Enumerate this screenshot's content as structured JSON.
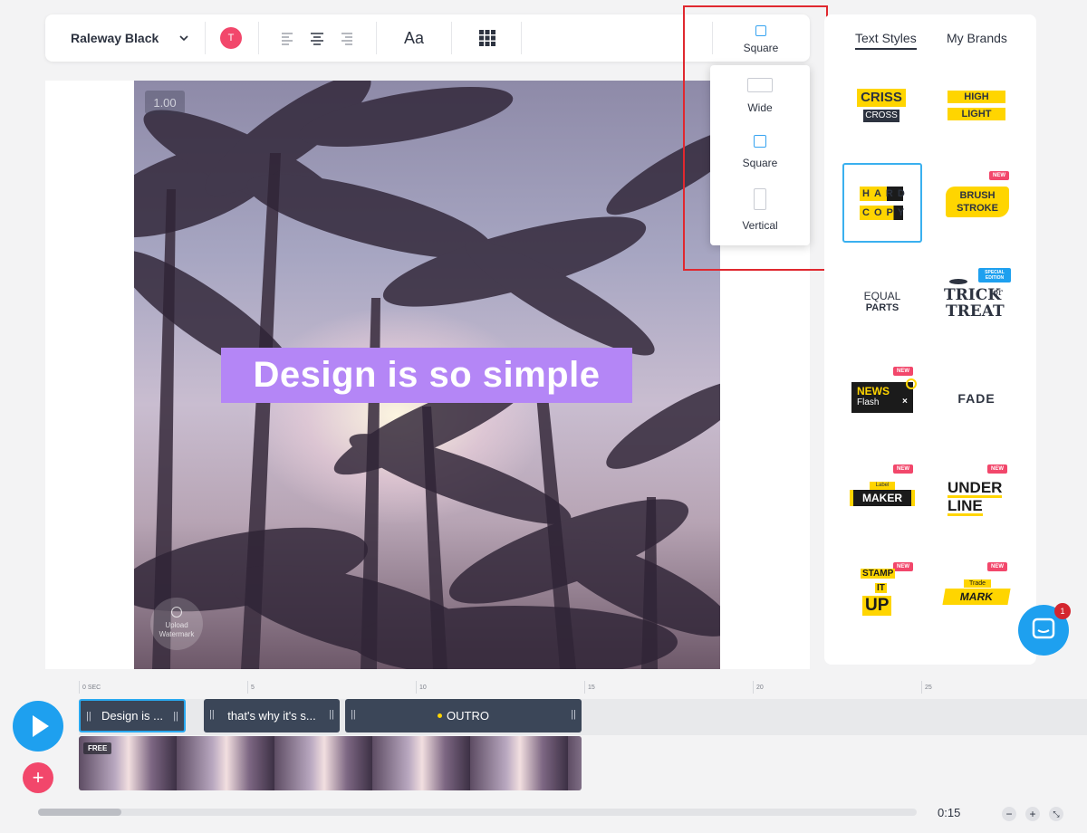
{
  "toolbar": {
    "font_name": "Raleway Black",
    "color_letter": "T",
    "text_size_label": "Aa",
    "aspect_label": "Square"
  },
  "canvas": {
    "zoom_label": "1.00",
    "headline": "Design is so simple",
    "upload_label": "Upload Watermark"
  },
  "aspect_menu": {
    "options": [
      {
        "label": "Wide"
      },
      {
        "label": "Square"
      },
      {
        "label": "Vertical"
      }
    ]
  },
  "panel": {
    "tabs": [
      {
        "label": "Text Styles",
        "active": true
      },
      {
        "label": "My Brands",
        "active": false
      }
    ],
    "new_badge": "NEW",
    "special_badge": "SPECIAL EDITION",
    "styles": [
      {
        "name": "criss-cross",
        "lines": [
          "CRISS",
          "CROSS"
        ]
      },
      {
        "name": "highlight",
        "lines": [
          "HIGH",
          "LIGHT"
        ]
      },
      {
        "name": "hard-copy",
        "lines": [
          "HARD",
          "COPY"
        ],
        "selected": true
      },
      {
        "name": "brush-stroke",
        "lines": [
          "BRUSH",
          "STROKE"
        ],
        "new": true
      },
      {
        "name": "equal-parts",
        "lines": [
          "EQUAL",
          "PARTS"
        ]
      },
      {
        "name": "trick-or-treat",
        "lines": [
          "TRICK",
          "or",
          "TREAT"
        ]
      },
      {
        "name": "news-flash",
        "lines": [
          "NEWS",
          "Flash"
        ],
        "new": true
      },
      {
        "name": "fade",
        "lines": [
          "FADE"
        ]
      },
      {
        "name": "label-maker",
        "lines": [
          "Label",
          "MAKER"
        ],
        "new": true
      },
      {
        "name": "underline",
        "lines": [
          "UNDER",
          "LINE"
        ],
        "new": true
      },
      {
        "name": "stamp-it-up",
        "lines": [
          "STAMP",
          "IT",
          "UP"
        ],
        "new": true
      },
      {
        "name": "trademark",
        "lines": [
          "Trade",
          "MARK"
        ],
        "new": true
      }
    ]
  },
  "timeline": {
    "ticks": [
      "0 SEC",
      "5",
      "10",
      "15",
      "20",
      "25"
    ],
    "clips": [
      {
        "label": "Design is ...",
        "selected": true
      },
      {
        "label": "that's why it's s...",
        "selected": false
      },
      {
        "label": "OUTRO",
        "selected": false
      }
    ],
    "free_badge": "FREE",
    "duration": "0:15",
    "zoom_out": "−",
    "zoom_in": "+",
    "chat_count": "1",
    "progress_fraction": 0.09
  },
  "colors": {
    "accent_blue": "#1ea0ef",
    "accent_pink": "#f2476b",
    "headline_bg": "#b486f6",
    "highlight_red": "#e0282f"
  }
}
